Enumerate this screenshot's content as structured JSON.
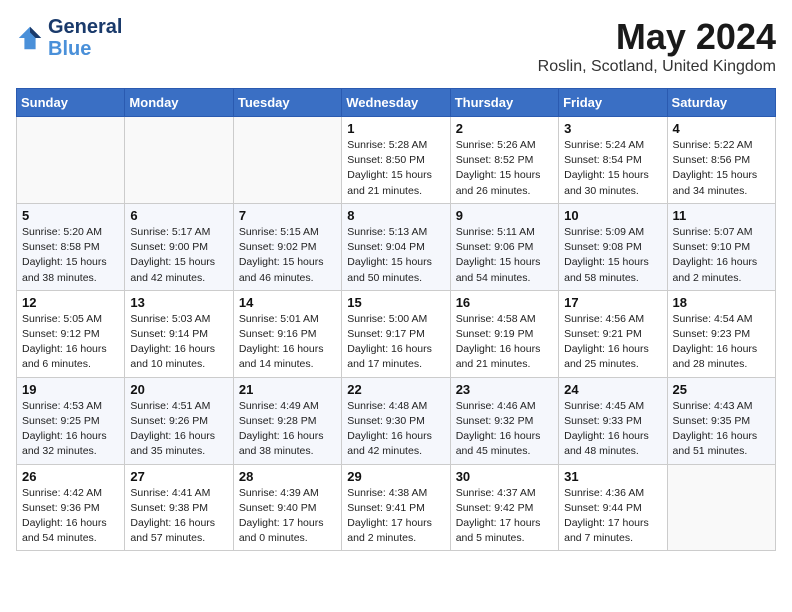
{
  "header": {
    "logo_line1": "General",
    "logo_line2": "Blue",
    "month": "May 2024",
    "location": "Roslin, Scotland, United Kingdom"
  },
  "weekdays": [
    "Sunday",
    "Monday",
    "Tuesday",
    "Wednesday",
    "Thursday",
    "Friday",
    "Saturday"
  ],
  "weeks": [
    [
      {
        "day": "",
        "info": ""
      },
      {
        "day": "",
        "info": ""
      },
      {
        "day": "",
        "info": ""
      },
      {
        "day": "1",
        "info": "Sunrise: 5:28 AM\nSunset: 8:50 PM\nDaylight: 15 hours\nand 21 minutes."
      },
      {
        "day": "2",
        "info": "Sunrise: 5:26 AM\nSunset: 8:52 PM\nDaylight: 15 hours\nand 26 minutes."
      },
      {
        "day": "3",
        "info": "Sunrise: 5:24 AM\nSunset: 8:54 PM\nDaylight: 15 hours\nand 30 minutes."
      },
      {
        "day": "4",
        "info": "Sunrise: 5:22 AM\nSunset: 8:56 PM\nDaylight: 15 hours\nand 34 minutes."
      }
    ],
    [
      {
        "day": "5",
        "info": "Sunrise: 5:20 AM\nSunset: 8:58 PM\nDaylight: 15 hours\nand 38 minutes."
      },
      {
        "day": "6",
        "info": "Sunrise: 5:17 AM\nSunset: 9:00 PM\nDaylight: 15 hours\nand 42 minutes."
      },
      {
        "day": "7",
        "info": "Sunrise: 5:15 AM\nSunset: 9:02 PM\nDaylight: 15 hours\nand 46 minutes."
      },
      {
        "day": "8",
        "info": "Sunrise: 5:13 AM\nSunset: 9:04 PM\nDaylight: 15 hours\nand 50 minutes."
      },
      {
        "day": "9",
        "info": "Sunrise: 5:11 AM\nSunset: 9:06 PM\nDaylight: 15 hours\nand 54 minutes."
      },
      {
        "day": "10",
        "info": "Sunrise: 5:09 AM\nSunset: 9:08 PM\nDaylight: 15 hours\nand 58 minutes."
      },
      {
        "day": "11",
        "info": "Sunrise: 5:07 AM\nSunset: 9:10 PM\nDaylight: 16 hours\nand 2 minutes."
      }
    ],
    [
      {
        "day": "12",
        "info": "Sunrise: 5:05 AM\nSunset: 9:12 PM\nDaylight: 16 hours\nand 6 minutes."
      },
      {
        "day": "13",
        "info": "Sunrise: 5:03 AM\nSunset: 9:14 PM\nDaylight: 16 hours\nand 10 minutes."
      },
      {
        "day": "14",
        "info": "Sunrise: 5:01 AM\nSunset: 9:16 PM\nDaylight: 16 hours\nand 14 minutes."
      },
      {
        "day": "15",
        "info": "Sunrise: 5:00 AM\nSunset: 9:17 PM\nDaylight: 16 hours\nand 17 minutes."
      },
      {
        "day": "16",
        "info": "Sunrise: 4:58 AM\nSunset: 9:19 PM\nDaylight: 16 hours\nand 21 minutes."
      },
      {
        "day": "17",
        "info": "Sunrise: 4:56 AM\nSunset: 9:21 PM\nDaylight: 16 hours\nand 25 minutes."
      },
      {
        "day": "18",
        "info": "Sunrise: 4:54 AM\nSunset: 9:23 PM\nDaylight: 16 hours\nand 28 minutes."
      }
    ],
    [
      {
        "day": "19",
        "info": "Sunrise: 4:53 AM\nSunset: 9:25 PM\nDaylight: 16 hours\nand 32 minutes."
      },
      {
        "day": "20",
        "info": "Sunrise: 4:51 AM\nSunset: 9:26 PM\nDaylight: 16 hours\nand 35 minutes."
      },
      {
        "day": "21",
        "info": "Sunrise: 4:49 AM\nSunset: 9:28 PM\nDaylight: 16 hours\nand 38 minutes."
      },
      {
        "day": "22",
        "info": "Sunrise: 4:48 AM\nSunset: 9:30 PM\nDaylight: 16 hours\nand 42 minutes."
      },
      {
        "day": "23",
        "info": "Sunrise: 4:46 AM\nSunset: 9:32 PM\nDaylight: 16 hours\nand 45 minutes."
      },
      {
        "day": "24",
        "info": "Sunrise: 4:45 AM\nSunset: 9:33 PM\nDaylight: 16 hours\nand 48 minutes."
      },
      {
        "day": "25",
        "info": "Sunrise: 4:43 AM\nSunset: 9:35 PM\nDaylight: 16 hours\nand 51 minutes."
      }
    ],
    [
      {
        "day": "26",
        "info": "Sunrise: 4:42 AM\nSunset: 9:36 PM\nDaylight: 16 hours\nand 54 minutes."
      },
      {
        "day": "27",
        "info": "Sunrise: 4:41 AM\nSunset: 9:38 PM\nDaylight: 16 hours\nand 57 minutes."
      },
      {
        "day": "28",
        "info": "Sunrise: 4:39 AM\nSunset: 9:40 PM\nDaylight: 17 hours\nand 0 minutes."
      },
      {
        "day": "29",
        "info": "Sunrise: 4:38 AM\nSunset: 9:41 PM\nDaylight: 17 hours\nand 2 minutes."
      },
      {
        "day": "30",
        "info": "Sunrise: 4:37 AM\nSunset: 9:42 PM\nDaylight: 17 hours\nand 5 minutes."
      },
      {
        "day": "31",
        "info": "Sunrise: 4:36 AM\nSunset: 9:44 PM\nDaylight: 17 hours\nand 7 minutes."
      },
      {
        "day": "",
        "info": ""
      }
    ]
  ]
}
